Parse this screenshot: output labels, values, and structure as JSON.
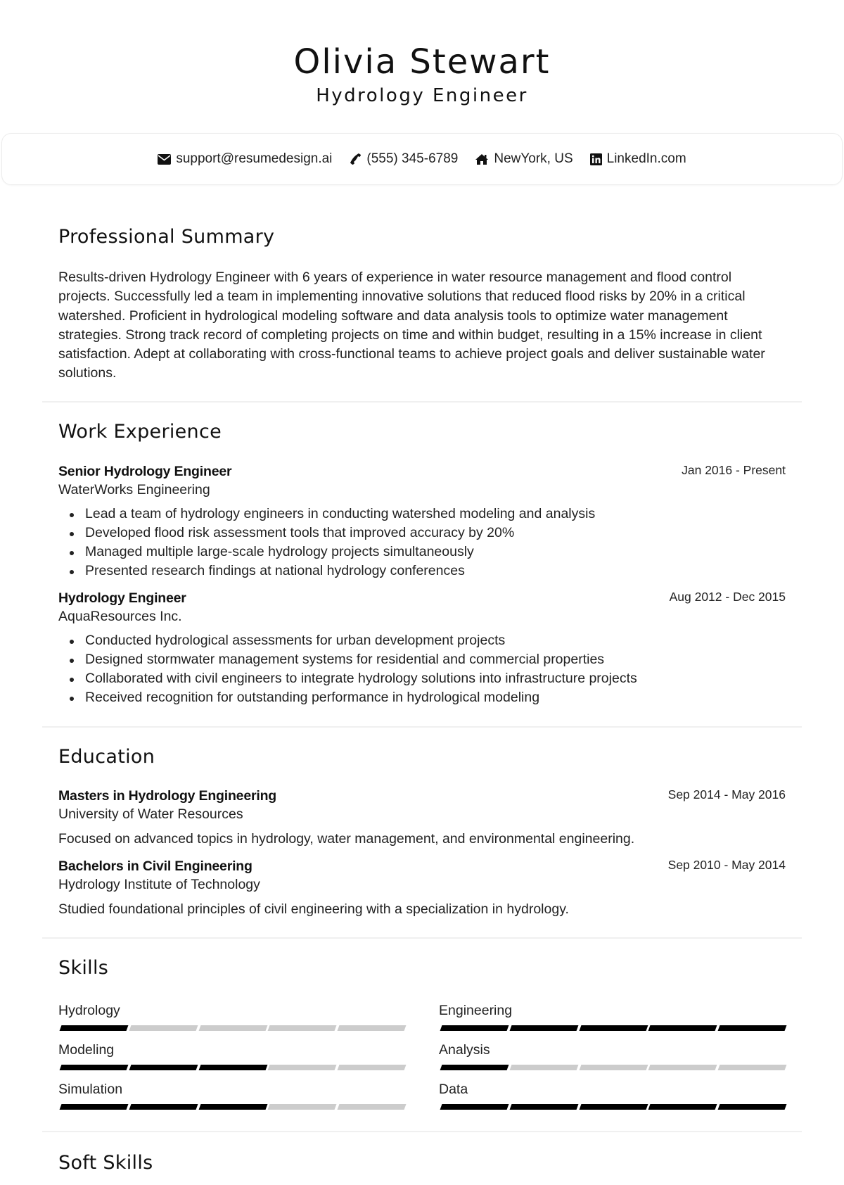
{
  "header": {
    "name": "Olivia Stewart",
    "role": "Hydrology Engineer"
  },
  "contact": [
    {
      "icon": "envelope-icon",
      "text": "support@resumedesign.ai"
    },
    {
      "icon": "phone-icon",
      "text": "(555) 345-6789"
    },
    {
      "icon": "home-icon",
      "text": "NewYork, US"
    },
    {
      "icon": "linkedin-icon",
      "text": "LinkedIn.com"
    }
  ],
  "summary": {
    "title": "Professional Summary",
    "text": "Results-driven Hydrology Engineer with 6 years of experience in water resource management and flood control projects. Successfully led a team in implementing innovative solutions that reduced flood risks by 20% in a critical watershed. Proficient in hydrological modeling software and data analysis tools to optimize water management strategies. Strong track record of completing projects on time and within budget, resulting in a 15% increase in client satisfaction. Adept at collaborating with cross-functional teams to achieve project goals and deliver sustainable water solutions."
  },
  "experience": {
    "title": "Work Experience",
    "jobs": [
      {
        "title": "Senior Hydrology Engineer",
        "company": "WaterWorks Engineering",
        "date": "Jan 2016 - Present",
        "bullets": [
          "Lead a team of hydrology engineers in conducting watershed modeling and analysis",
          "Developed flood risk assessment tools that improved accuracy by 20%",
          "Managed multiple large-scale hydrology projects simultaneously",
          "Presented research findings at national hydrology conferences"
        ]
      },
      {
        "title": "Hydrology Engineer",
        "company": "AquaResources Inc.",
        "date": "Aug 2012 - Dec 2015",
        "bullets": [
          "Conducted hydrological assessments for urban development projects",
          "Designed stormwater management systems for residential and commercial properties",
          "Collaborated with civil engineers to integrate hydrology solutions into infrastructure projects",
          "Received recognition for outstanding performance in hydrological modeling"
        ]
      }
    ]
  },
  "education": {
    "title": "Education",
    "items": [
      {
        "degree": "Masters in Hydrology Engineering",
        "school": "University of Water Resources",
        "date": "Sep 2014 - May 2016",
        "description": "Focused on advanced topics in hydrology, water management, and environmental engineering."
      },
      {
        "degree": "Bachelors in Civil Engineering",
        "school": "Hydrology Institute of Technology",
        "date": "Sep 2010 - May 2014",
        "description": "Studied foundational principles of civil engineering with a specialization in hydrology."
      }
    ]
  },
  "skills": {
    "title": "Skills",
    "max_level": 5,
    "items": [
      {
        "name": "Hydrology",
        "level": 1
      },
      {
        "name": "Engineering",
        "level": 5
      },
      {
        "name": "Modeling",
        "level": 3
      },
      {
        "name": "Analysis",
        "level": 1
      },
      {
        "name": "Simulation",
        "level": 3
      },
      {
        "name": "Data",
        "level": 5
      }
    ]
  },
  "soft_skills": {
    "title": "Soft Skills"
  }
}
